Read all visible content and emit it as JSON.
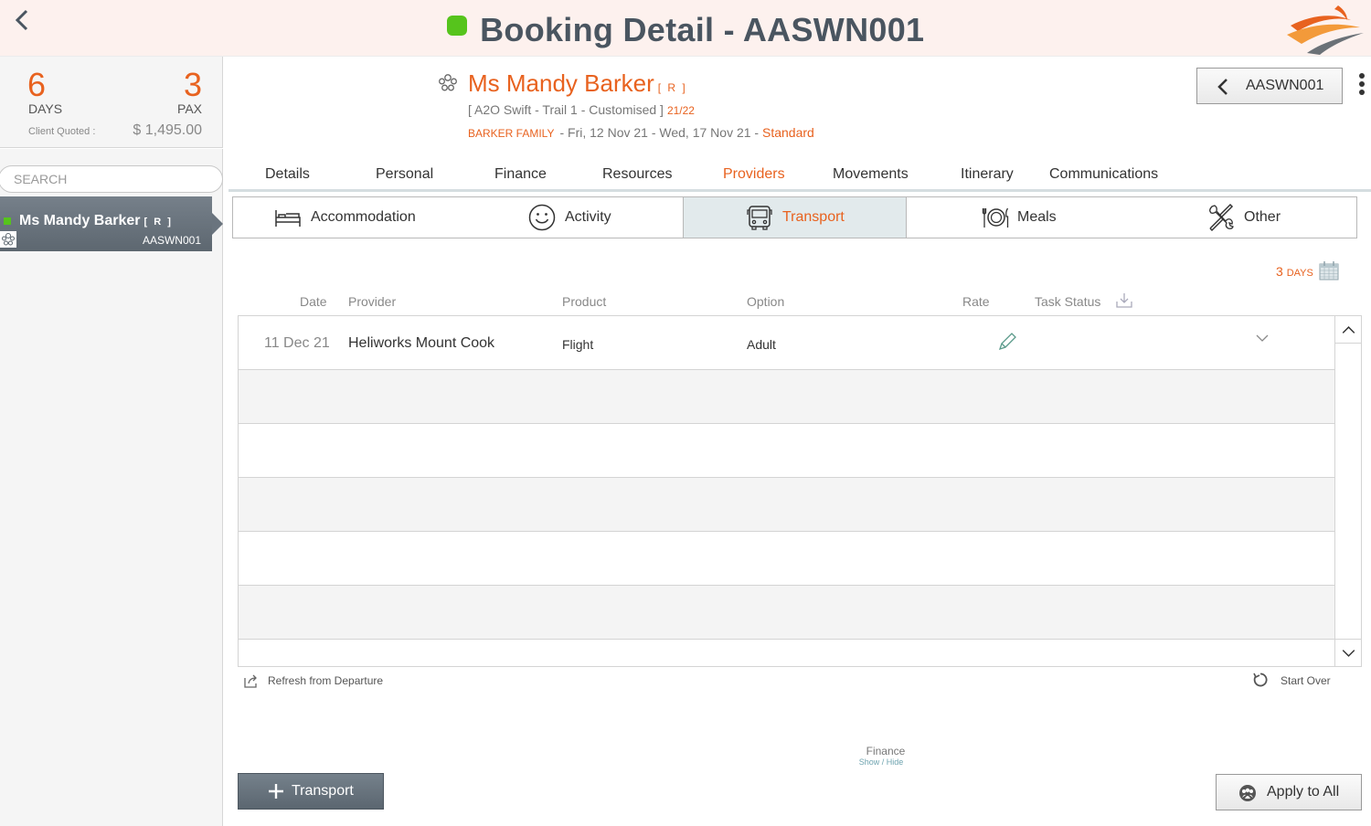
{
  "header": {
    "title": "Booking Detail - AASWN001",
    "status_color": "#56c41c",
    "back_icon": "chevron-left-icon",
    "logo": "swoosh-logo"
  },
  "stats": {
    "days_value": "6",
    "days_label": "DAYS",
    "pax_value": "3",
    "pax_label": "PAX",
    "client_quoted_label": "Client Quoted :",
    "client_quoted_value": "$ 1,495.00"
  },
  "sidebar": {
    "search_placeholder": "SEARCH",
    "items": [
      {
        "name": "Ms Mandy Barker",
        "tag": "[ R ]",
        "code": "AASWN001"
      }
    ]
  },
  "booking": {
    "client_name": "Ms Mandy Barker",
    "client_tag": "[ R ]",
    "tour": "[ A2O Swift - Trail 1 - Customised ]",
    "season": "21/22",
    "family": "BARKER FAMILY",
    "dates": "- Fri, 12 Nov 21 - Wed, 17 Nov 21 -",
    "tier": "Standard",
    "code_nav_label": "AASWN001"
  },
  "main_tabs": [
    {
      "label": "Details"
    },
    {
      "label": "Personal"
    },
    {
      "label": "Finance"
    },
    {
      "label": "Resources"
    },
    {
      "label": "Providers",
      "active": true
    },
    {
      "label": "Movements"
    },
    {
      "label": "Itinerary"
    },
    {
      "label": "Communications"
    }
  ],
  "sub_tabs": [
    {
      "label": "Accommodation",
      "icon": "bed-icon"
    },
    {
      "label": "Activity",
      "icon": "smiley-icon"
    },
    {
      "label": "Transport",
      "icon": "bus-icon",
      "active": true
    },
    {
      "label": "Meals",
      "icon": "plate-cutlery-icon"
    },
    {
      "label": "Other",
      "icon": "tools-icon"
    }
  ],
  "days_indicator": {
    "num": "3",
    "label": "Days"
  },
  "table": {
    "headers": {
      "date": "Date",
      "provider": "Provider",
      "product": "Product",
      "option": "Option",
      "rate": "Rate",
      "task_status": "Task Status"
    },
    "rows": [
      {
        "date": "11 Dec 21",
        "provider": "Heliworks Mount Cook",
        "product": "Flight",
        "option": "Adult"
      }
    ]
  },
  "footer": {
    "refresh_label": "Refresh from Departure",
    "start_over_label": "Start Over",
    "finance_label": "Finance",
    "finance_toggle": "Show / Hide",
    "add_label": "Transport",
    "apply_label": "Apply to All"
  },
  "colors": {
    "accent": "#e8621f",
    "slate": "#4a5560",
    "status_green": "#56c41c"
  }
}
